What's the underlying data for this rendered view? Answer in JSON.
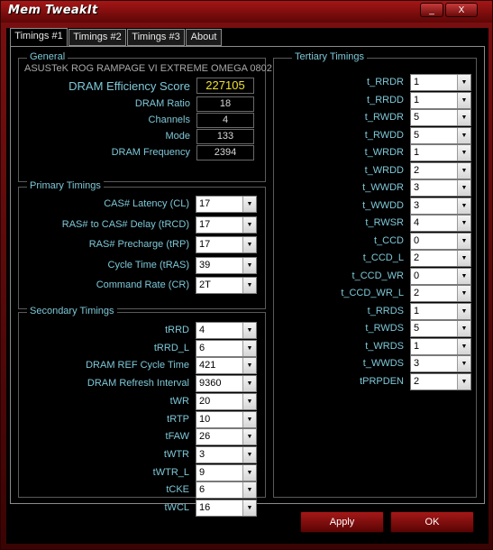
{
  "window": {
    "title": "Mem TweakIt",
    "minimize": "_",
    "close": "X"
  },
  "tabs": [
    "Timings #1",
    "Timings #2",
    "Timings #3",
    "About"
  ],
  "general": {
    "title": "General",
    "board": "ASUSTeK ROG RAMPAGE VI EXTREME OMEGA 0802",
    "efficiency_label": "DRAM Efficiency Score",
    "efficiency_value": "227105",
    "rows": [
      {
        "label": "DRAM Ratio",
        "value": "18"
      },
      {
        "label": "Channels",
        "value": "4"
      },
      {
        "label": "Mode",
        "value": "133"
      },
      {
        "label": "DRAM Frequency",
        "value": "2394"
      }
    ]
  },
  "primary": {
    "title": "Primary Timings",
    "rows": [
      {
        "label": "CAS# Latency (CL)",
        "value": "17"
      },
      {
        "label": "RAS# to CAS# Delay (tRCD)",
        "value": "17"
      },
      {
        "label": "RAS# Precharge (tRP)",
        "value": "17"
      },
      {
        "label": "Cycle Time (tRAS)",
        "value": "39"
      },
      {
        "label": "Command Rate (CR)",
        "value": "2T"
      }
    ]
  },
  "secondary": {
    "title": "Secondary Timings",
    "rows": [
      {
        "label": "tRRD",
        "value": "4"
      },
      {
        "label": "tRRD_L",
        "value": "6"
      },
      {
        "label": "DRAM REF Cycle Time",
        "value": "421"
      },
      {
        "label": "DRAM Refresh Interval",
        "value": "9360"
      },
      {
        "label": "tWR",
        "value": "20"
      },
      {
        "label": "tRTP",
        "value": "10"
      },
      {
        "label": "tFAW",
        "value": "26"
      },
      {
        "label": "tWTR",
        "value": "3"
      },
      {
        "label": "tWTR_L",
        "value": "9"
      },
      {
        "label": "tCKE",
        "value": "6"
      },
      {
        "label": "tWCL",
        "value": "16"
      }
    ]
  },
  "tertiary": {
    "title": "Tertiary Timings",
    "rows": [
      {
        "label": "t_RRDR",
        "value": "1"
      },
      {
        "label": "t_RRDD",
        "value": "1"
      },
      {
        "label": "t_RWDR",
        "value": "5"
      },
      {
        "label": "t_RWDD",
        "value": "5"
      },
      {
        "label": "t_WRDR",
        "value": "1"
      },
      {
        "label": "t_WRDD",
        "value": "2"
      },
      {
        "label": "t_WWDR",
        "value": "3"
      },
      {
        "label": "t_WWDD",
        "value": "3"
      },
      {
        "label": "t_RWSR",
        "value": "4"
      },
      {
        "label": "t_CCD",
        "value": "0"
      },
      {
        "label": "t_CCD_L",
        "value": "2"
      },
      {
        "label": "t_CCD_WR",
        "value": "0"
      },
      {
        "label": "t_CCD_WR_L",
        "value": "2"
      },
      {
        "label": "t_RRDS",
        "value": "1"
      },
      {
        "label": "t_RWDS",
        "value": "5"
      },
      {
        "label": "t_WRDS",
        "value": "1"
      },
      {
        "label": "t_WWDS",
        "value": "3"
      },
      {
        "label": "tPRPDEN",
        "value": "2"
      }
    ]
  },
  "buttons": {
    "apply": "Apply",
    "ok": "OK"
  },
  "colors": {
    "accent": "#a51616",
    "label": "#7ec8d8",
    "highlight": "#f0e030"
  }
}
